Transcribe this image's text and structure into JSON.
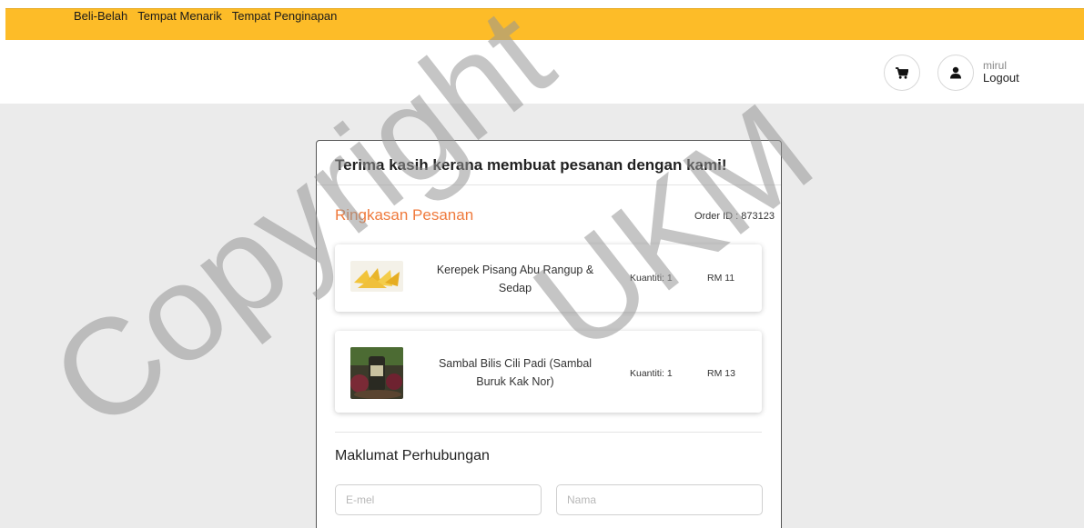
{
  "nav": {
    "items": [
      "Beli-Belah",
      "Tempat Menarik",
      "Tempat Penginapan"
    ]
  },
  "header": {
    "cart_icon": "shopping-cart-icon",
    "user_icon": "user-icon",
    "username": "mirul",
    "logout_label": "Logout"
  },
  "order": {
    "thank_you": "Terima kasih kerana membuat pesanan dengan kami!",
    "summary_title": "Ringkasan Pesanan",
    "order_id": "Order ID : 873123",
    "items": [
      {
        "name": "Kerepek Pisang Abu Rangup & Sedap",
        "quantity": "Kuantiti: 1",
        "price": "RM 11"
      },
      {
        "name": "Sambal Bilis Cili Padi (Sambal Buruk Kak Nor)",
        "quantity": "Kuantiti: 1",
        "price": "RM 13"
      }
    ]
  },
  "contact": {
    "title": "Maklumat Perhubungan",
    "email_placeholder": "E-mel",
    "name_placeholder": "Nama"
  },
  "watermark": {
    "text1": "Copyright",
    "text2": "UKM"
  },
  "colors": {
    "topbar": "#fdbc28",
    "accent": "#ef7a3c",
    "background": "#ebebeb"
  }
}
